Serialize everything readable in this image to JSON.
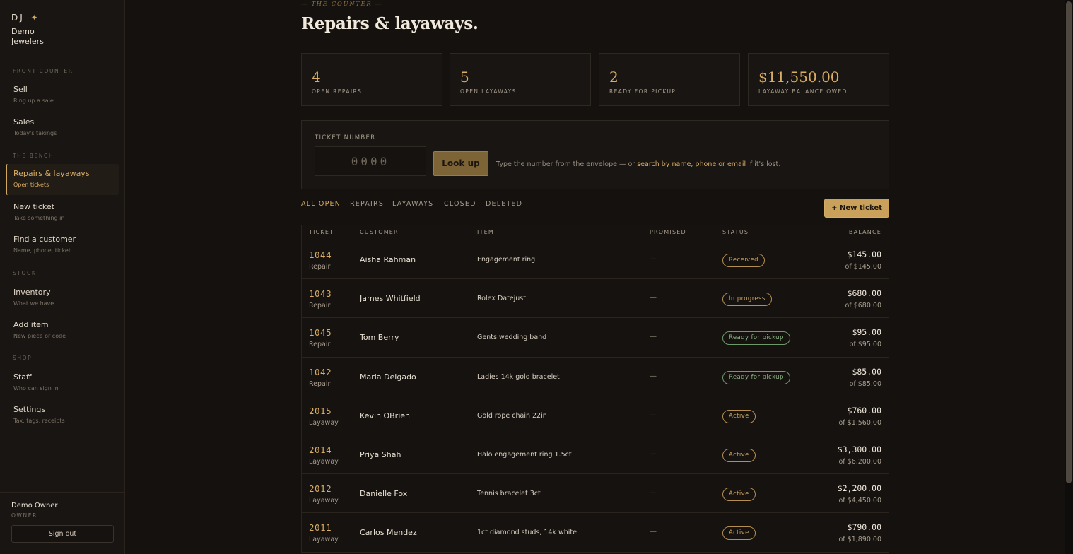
{
  "brand": {
    "mark": "DJ",
    "star": "✦",
    "name": "Demo Jewelers"
  },
  "sidebar": {
    "sections": [
      {
        "title": "FRONT COUNTER"
      },
      {
        "title": "THE BENCH"
      },
      {
        "title": "STOCK"
      },
      {
        "title": "SHOP"
      }
    ],
    "items": [
      {
        "label": "Sell",
        "sub": "Ring up a sale"
      },
      {
        "label": "Sales",
        "sub": "Today's takings"
      },
      {
        "label": "Repairs & layaways",
        "sub": "Open tickets",
        "active": true
      },
      {
        "label": "New ticket",
        "sub": "Take something in"
      },
      {
        "label": "Find a customer",
        "sub": "Name, phone, ticket"
      },
      {
        "label": "Inventory",
        "sub": "What we have"
      },
      {
        "label": "Add item",
        "sub": "New piece or code"
      },
      {
        "label": "Staff",
        "sub": "Who can sign in"
      },
      {
        "label": "Settings",
        "sub": "Tax, tags, receipts"
      }
    ],
    "user": {
      "name": "Demo Owner",
      "role": "OWNER",
      "signout": "Sign out"
    }
  },
  "header": {
    "eyebrow": "— THE COUNTER —",
    "title": "Repairs & layaways."
  },
  "stats": [
    {
      "value": "4",
      "label": "OPEN REPAIRS"
    },
    {
      "value": "5",
      "label": "OPEN LAYAWAYS"
    },
    {
      "value": "2",
      "label": "READY FOR PICKUP"
    },
    {
      "value": "$11,550.00",
      "label": "LAYAWAY BALANCE OWED"
    }
  ],
  "lookup": {
    "label": "TICKET NUMBER",
    "placeholder": "0000",
    "button": "Look up",
    "hint_pre": "Type the number from the envelope — or ",
    "hint_link": "search by name, phone or email",
    "hint_post": " if it's lost."
  },
  "tabs": [
    {
      "label": "ALL OPEN",
      "active": true
    },
    {
      "label": "REPAIRS"
    },
    {
      "label": "LAYAWAYS"
    },
    {
      "label": "CLOSED"
    },
    {
      "label": "DELETED"
    }
  ],
  "new_ticket_button": "+ New ticket",
  "table": {
    "columns": [
      "TICKET",
      "CUSTOMER",
      "ITEM",
      "PROMISED",
      "STATUS",
      "BALANCE"
    ],
    "rows": [
      {
        "ticket": "1044",
        "type": "Repair",
        "customer": "Aisha Rahman",
        "item": "Engagement ring",
        "promised": "—",
        "status": "Received",
        "status_tone": "gold",
        "balance": "$145.00",
        "of": "of $145.00"
      },
      {
        "ticket": "1043",
        "type": "Repair",
        "customer": "James Whitfield",
        "item": "Rolex Datejust",
        "promised": "—",
        "status": "In progress",
        "status_tone": "gold",
        "balance": "$680.00",
        "of": "of $680.00"
      },
      {
        "ticket": "1045",
        "type": "Repair",
        "customer": "Tom Berry",
        "item": "Gents wedding band",
        "promised": "—",
        "status": "Ready for pickup",
        "status_tone": "green",
        "balance": "$95.00",
        "of": "of $95.00"
      },
      {
        "ticket": "1042",
        "type": "Repair",
        "customer": "Maria Delgado",
        "item": "Ladies 14k gold bracelet",
        "promised": "—",
        "status": "Ready for pickup",
        "status_tone": "green",
        "balance": "$85.00",
        "of": "of $85.00"
      },
      {
        "ticket": "2015",
        "type": "Layaway",
        "customer": "Kevin OBrien",
        "item": "Gold rope chain 22in",
        "promised": "—",
        "status": "Active",
        "status_tone": "gold",
        "balance": "$760.00",
        "of": "of $1,560.00"
      },
      {
        "ticket": "2014",
        "type": "Layaway",
        "customer": "Priya Shah",
        "item": "Halo engagement ring 1.5ct",
        "promised": "—",
        "status": "Active",
        "status_tone": "gold",
        "balance": "$3,300.00",
        "of": "of $6,200.00"
      },
      {
        "ticket": "2012",
        "type": "Layaway",
        "customer": "Danielle Fox",
        "item": "Tennis bracelet 3ct",
        "promised": "—",
        "status": "Active",
        "status_tone": "gold",
        "balance": "$2,200.00",
        "of": "of $4,450.00"
      },
      {
        "ticket": "2011",
        "type": "Layaway",
        "customer": "Carlos Mendez",
        "item": "1ct diamond studs, 14k white",
        "promised": "—",
        "status": "Active",
        "status_tone": "gold",
        "balance": "$790.00",
        "of": "of $1,890.00"
      }
    ]
  },
  "colors": {
    "accent": "#d9ad63",
    "background": "#14110e",
    "ready": "#8cb585"
  }
}
